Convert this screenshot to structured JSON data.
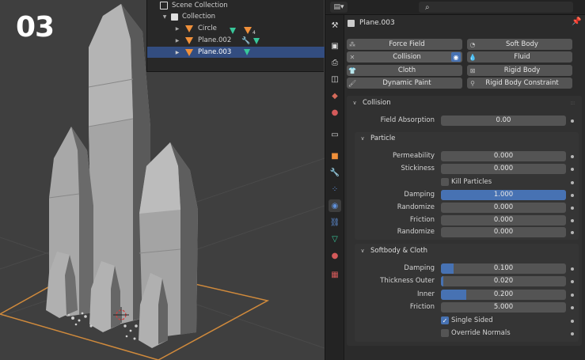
{
  "step": "03",
  "outliner": {
    "rows": [
      {
        "label": "Scene Collection",
        "icon": "scene-collection-icon"
      },
      {
        "label": "Collection",
        "icon": "collection-icon"
      },
      {
        "label": "Circle",
        "icon": "mesh-object-icon",
        "badge": "4"
      },
      {
        "label": "Plane.002",
        "icon": "mesh-object-icon"
      },
      {
        "label": "Plane.003",
        "icon": "mesh-object-icon",
        "selected": true
      }
    ]
  },
  "properties": {
    "object_name": "Plane.003",
    "physics_buttons": {
      "force_field": "Force Field",
      "soft_body": "Soft Body",
      "collision": "Collision",
      "fluid": "Fluid",
      "cloth": "Cloth",
      "rigid_body": "Rigid Body",
      "dynamic_paint": "Dynamic Paint",
      "rigid_body_constraint": "Rigid Body Constraint"
    },
    "collision": {
      "title": "Collision",
      "field_absorption": {
        "label": "Field Absorption",
        "value": "0.00",
        "fraction": 0
      },
      "particle": {
        "title": "Particle",
        "permeability": {
          "label": "Permeability",
          "value": "0.000",
          "fraction": 0
        },
        "stickiness": {
          "label": "Stickiness",
          "value": "0.000",
          "fraction": 0
        },
        "kill_particles": {
          "label": "Kill Particles",
          "checked": false
        },
        "damping": {
          "label": "Damping",
          "value": "1.000",
          "fraction": 1
        },
        "damping_randomize": {
          "label": "Randomize",
          "value": "0.000",
          "fraction": 0
        },
        "friction": {
          "label": "Friction",
          "value": "0.000",
          "fraction": 0
        },
        "friction_randomize": {
          "label": "Randomize",
          "value": "0.000",
          "fraction": 0
        }
      },
      "softbody_cloth": {
        "title": "Softbody & Cloth",
        "damping": {
          "label": "Damping",
          "value": "0.100",
          "fraction": 0.1
        },
        "thickness_outer": {
          "label": "Thickness Outer",
          "value": "0.020",
          "fraction": 0.02
        },
        "inner": {
          "label": "Inner",
          "value": "0.200",
          "fraction": 0.2
        },
        "friction": {
          "label": "Friction",
          "value": "5.000",
          "fraction": 0
        },
        "single_sided": {
          "label": "Single Sided",
          "checked": true
        },
        "override_normals": {
          "label": "Override Normals",
          "checked": false
        }
      }
    }
  },
  "colors": {
    "accent": "#4772b3",
    "selection": "#334d80",
    "object_orange": "#f0903a",
    "mesh_green": "#38c79a"
  }
}
